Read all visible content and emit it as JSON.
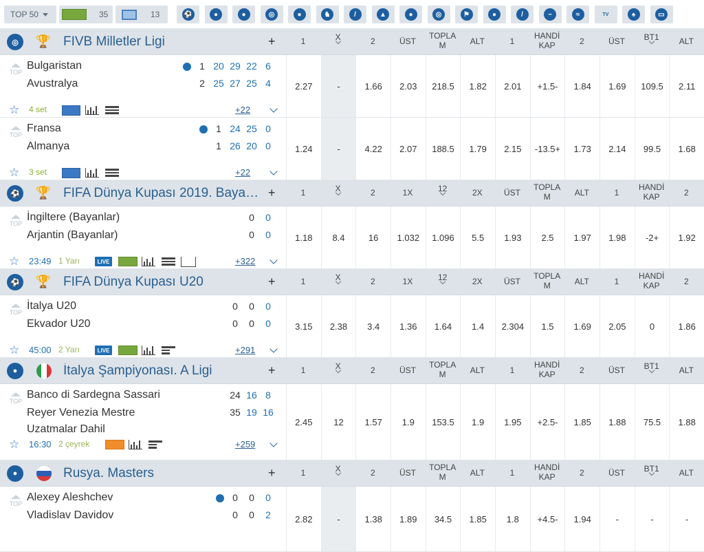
{
  "topbar": {
    "top50": "TOP 50",
    "pitch_count": "35",
    "screen_count": "13",
    "sports": [
      "football-icon",
      "basketball-icon",
      "tennis-icon",
      "volleyball-icon",
      "table-tennis-icon",
      "horse-racing-icon",
      "hockey-icon",
      "billiards-icon",
      "ice-hockey-icon",
      "darts-icon",
      "golf-icon",
      "rugby-icon",
      "badminton-icon",
      "water-polo-icon",
      "dog-racing-icon",
      "tv-bet-icon",
      "poker-icon",
      "esports-icon"
    ],
    "tvbet_label": "TV BET"
  },
  "leagues": [
    {
      "name": "FIVB Milletler Ligi",
      "plus": "+",
      "headers": [
        "1",
        "X",
        "2",
        "ÜST",
        "TOPLA M",
        "ALT",
        "1",
        "HANDİ KAP",
        "2",
        "ÜST",
        "BT1",
        "ALT"
      ],
      "matches": [
        {
          "top": "TOP",
          "team1": "Bulgaristan",
          "team2": "Avustralya",
          "s1": [
            "1",
            "20",
            "29",
            "22",
            "6"
          ],
          "s2": [
            "2",
            "25",
            "27",
            "25",
            "4"
          ],
          "status": "4 set",
          "more": "+22",
          "odds": [
            "2.27",
            "-",
            "1.66",
            "2.03",
            "218.5",
            "1.82",
            "2.01",
            "+1.5-",
            "1.84",
            "1.69",
            "109.5",
            "2.11"
          ]
        },
        {
          "top": "TOP",
          "team1": "Fransa",
          "team2": "Almanya",
          "s1": [
            "1",
            "24",
            "25",
            "0"
          ],
          "s2": [
            "1",
            "26",
            "20",
            "0"
          ],
          "status": "3 set",
          "more": "+22",
          "odds": [
            "1.24",
            "-",
            "4.22",
            "2.07",
            "188.5",
            "1.79",
            "2.15",
            "-13.5+",
            "1.73",
            "2.14",
            "99.5",
            "1.68"
          ]
        }
      ]
    },
    {
      "name": "FIFA Dünya Kupası 2019. Bayanlar",
      "plus": "+",
      "headers": [
        "1",
        "X",
        "2",
        "1X",
        "12",
        "2X",
        "ÜST",
        "TOPLA M",
        "ALT",
        "1",
        "HANDİ KAP",
        "2"
      ],
      "matches": [
        {
          "top": "TOP",
          "team1": "İngiltere (Bayanlar)",
          "team2": "Arjantin (Bayanlar)",
          "s1": [
            "0",
            "0"
          ],
          "s2": [
            "0",
            "0"
          ],
          "time": "23:49",
          "status": "1 Yarı",
          "more": "+322",
          "odds": [
            "1.18",
            "8.4",
            "16",
            "1.032",
            "1.096",
            "5.5",
            "1.93",
            "2.5",
            "1.97",
            "1.98",
            "-2+",
            "1.92"
          ]
        }
      ]
    },
    {
      "name": "FIFA Dünya Kupası U20",
      "plus": "+",
      "headers": [
        "1",
        "X",
        "2",
        "1X",
        "12",
        "2X",
        "ÜST",
        "TOPLA M",
        "ALT",
        "1",
        "HANDİ KAP",
        "2"
      ],
      "matches": [
        {
          "top": "TOP",
          "team1": "İtalya U20",
          "team2": "Ekvador U20",
          "s1": [
            "0",
            "0",
            "0"
          ],
          "s2": [
            "0",
            "0",
            "0"
          ],
          "time": "45:00",
          "status": "2 Yarı",
          "more": "+291",
          "odds": [
            "3.15",
            "2.38",
            "3.4",
            "1.36",
            "1.64",
            "1.4",
            "2.304",
            "1.5",
            "1.69",
            "2.05",
            "0",
            "1.86"
          ]
        }
      ]
    },
    {
      "name": "İtalya Şampiyonası. A Ligi",
      "plus": "+",
      "headers": [
        "1",
        "X",
        "2",
        "ÜST",
        "TOPLA M",
        "ALT",
        "1",
        "HANDİ KAP",
        "2",
        "ÜST",
        "BT1",
        "ALT"
      ],
      "matches": [
        {
          "top": "TOP",
          "team1": "Banco di Sardegna Sassari",
          "team2": "Reyer Venezia Mestre",
          "team3": "Uzatmalar Dahil",
          "s1": [
            "24",
            "16",
            "8"
          ],
          "s2": [
            "35",
            "19",
            "16"
          ],
          "time": "16:30",
          "status": "2 çeyrek",
          "more": "+259",
          "odds": [
            "2.45",
            "12",
            "1.57",
            "1.9",
            "153.5",
            "1.9",
            "1.95",
            "+2.5-",
            "1.85",
            "1.88",
            "75.5",
            "1.88"
          ]
        }
      ]
    },
    {
      "name": "Rusya. Masters",
      "plus": "+",
      "headers": [
        "1",
        "X",
        "2",
        "ÜST",
        "TOPLA M",
        "ALT",
        "1",
        "HANDİ KAP",
        "2",
        "ÜST",
        "BT1",
        "ALT"
      ],
      "matches": [
        {
          "top": "TOP",
          "team1": "Alexey Aleshchev",
          "team2": "Vladislav Davidov",
          "s1": [
            "0",
            "0",
            "0"
          ],
          "s2": [
            "0",
            "0",
            "2"
          ],
          "odds": [
            "2.82",
            "-",
            "1.38",
            "1.89",
            "34.5",
            "1.85",
            "1.8",
            "+4.5-",
            "1.94",
            "-",
            "-",
            "-"
          ]
        }
      ]
    }
  ]
}
